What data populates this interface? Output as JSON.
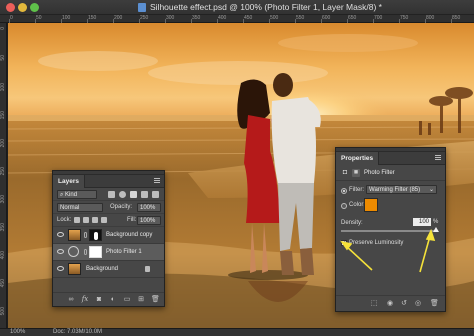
{
  "window": {
    "title": "Silhouette effect.psd @ 100% (Photo Filter 1, Layer Mask/8) *"
  },
  "rulers": {
    "top": [
      "0",
      "50",
      "100",
      "150",
      "200",
      "250",
      "300",
      "350",
      "400",
      "450",
      "500",
      "550",
      "600",
      "650",
      "700",
      "750",
      "800",
      "850"
    ],
    "left": [
      "0",
      "50",
      "100",
      "150",
      "200",
      "250",
      "300",
      "350",
      "400",
      "450",
      "500"
    ]
  },
  "layers_panel": {
    "tab": "Layers",
    "filter_kind": "Kind",
    "blend_mode": "Normal",
    "opacity_label": "Opacity:",
    "opacity_value": "100%",
    "lock_label": "Lock:",
    "fill_label": "Fill:",
    "fill_value": "100%",
    "layers": [
      {
        "name": "Background copy",
        "selected": false,
        "locked": false
      },
      {
        "name": "Photo Filter 1",
        "selected": true,
        "locked": false
      },
      {
        "name": "Background",
        "selected": false,
        "locked": true
      }
    ],
    "icons": [
      "link-icon",
      "fx-icon",
      "mask-icon",
      "adjustment-icon",
      "folder-icon",
      "new-layer-icon",
      "trash-icon"
    ]
  },
  "properties_panel": {
    "tab": "Properties",
    "adjustment_name": "Photo Filter",
    "filter_label": "Filter:",
    "filter_value": "Warming Filter (85)",
    "color_label": "Color:",
    "color_value": "#ec8a00",
    "density_label": "Density:",
    "density_value": "100",
    "density_unit": "%",
    "density_level": 1.0,
    "preserve_luminosity_label": "Preserve Luminosity",
    "preserve_luminosity_checked": true,
    "selected_option": "filter"
  },
  "status_bar": {
    "zoom": "100%",
    "doc": "Doc: 7.03M/10.0M"
  },
  "colors": {
    "annotation_arrow": "#f5e23a",
    "swatch": "#ec8a00"
  }
}
